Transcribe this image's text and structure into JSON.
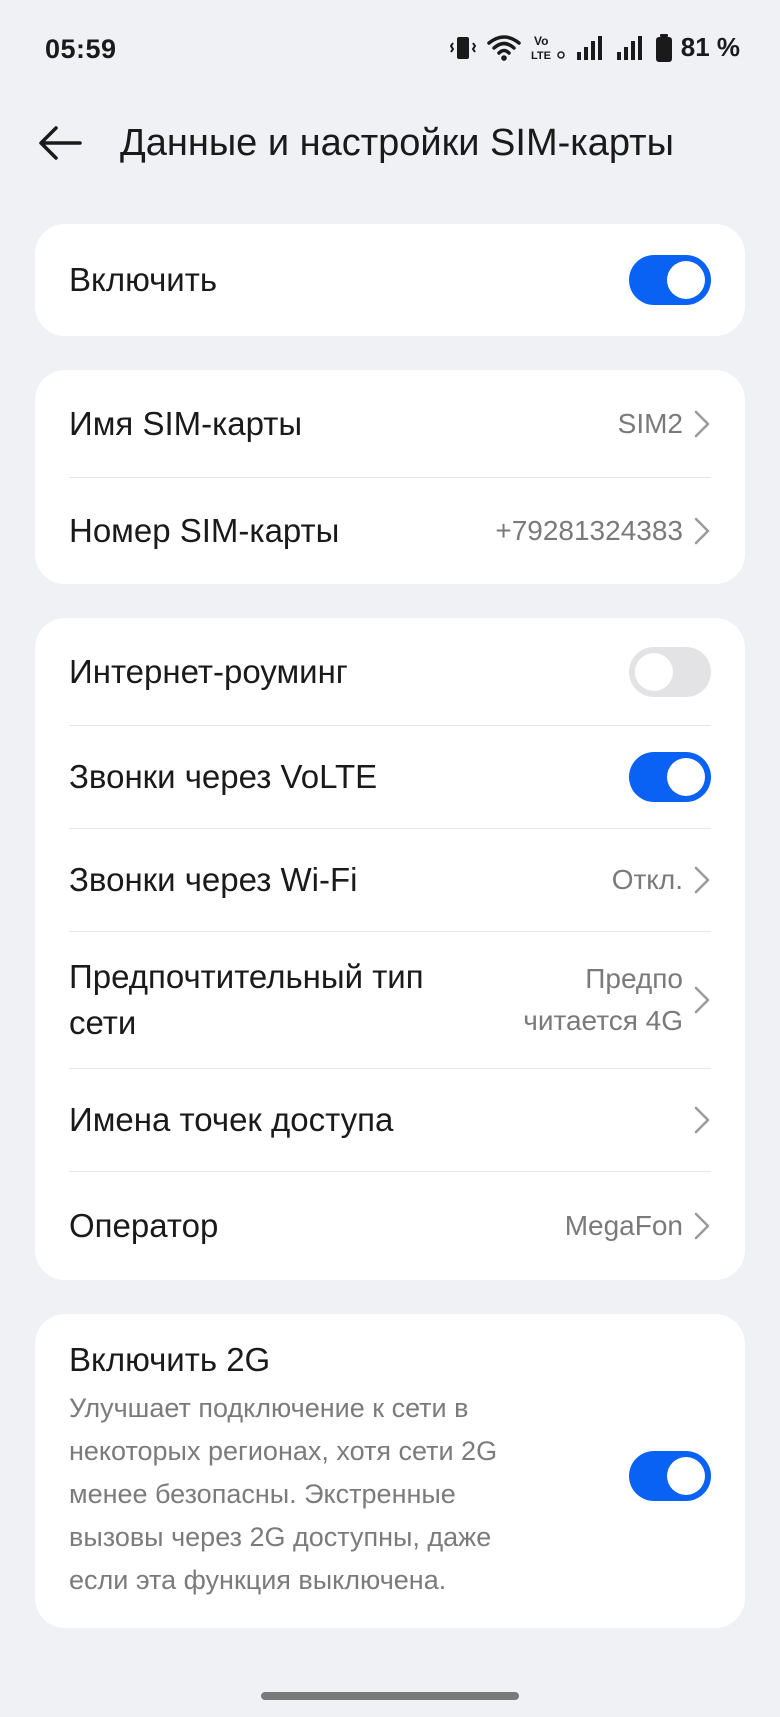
{
  "status_bar": {
    "time": "05:59",
    "volte_badge": "Vo LTE",
    "battery_percent": "81 %",
    "icons": [
      "vibrate-icon",
      "wifi-icon",
      "volte-icon",
      "signal-icon",
      "signal-icon",
      "battery-icon"
    ]
  },
  "header": {
    "title": "Данные и настройки SIM-карты",
    "back_icon": "arrow-left-icon"
  },
  "enable_card": {
    "label": "Включить",
    "enabled": true
  },
  "sim_info": {
    "name_label": "Имя SIM-карты",
    "name_value": "SIM2",
    "number_label": "Номер SIM-карты",
    "number_value": "+79281324383"
  },
  "network": {
    "roaming_label": "Интернет-роуминг",
    "roaming_enabled": false,
    "volte_label": "Звонки через VoLTE",
    "volte_enabled": true,
    "wifi_calls_label": "Звонки через Wi-Fi",
    "wifi_calls_value": "Откл.",
    "network_type_label_line1": "Предпочтительный тип",
    "network_type_label_line2": "сети",
    "network_type_value_line1": "Предпо",
    "network_type_value_line2": "читается 4G",
    "apn_label": "Имена точек доступа",
    "operator_label": "Оператор",
    "operator_value": "MegaFon"
  },
  "enable_2g": {
    "title": "Включить 2G",
    "description_lines": [
      "Улучшает подключение к сети в",
      "некоторых регионах, хотя сети 2G",
      "менее безопасны. Экстренные",
      "вызовы через 2G доступны, даже",
      "если эта функция выключена."
    ],
    "enabled": true
  },
  "colors": {
    "accent": "#0A62F5",
    "background": "#F0F1F5",
    "card": "#FFFFFF",
    "secondary_text": "#7A7A7A"
  }
}
